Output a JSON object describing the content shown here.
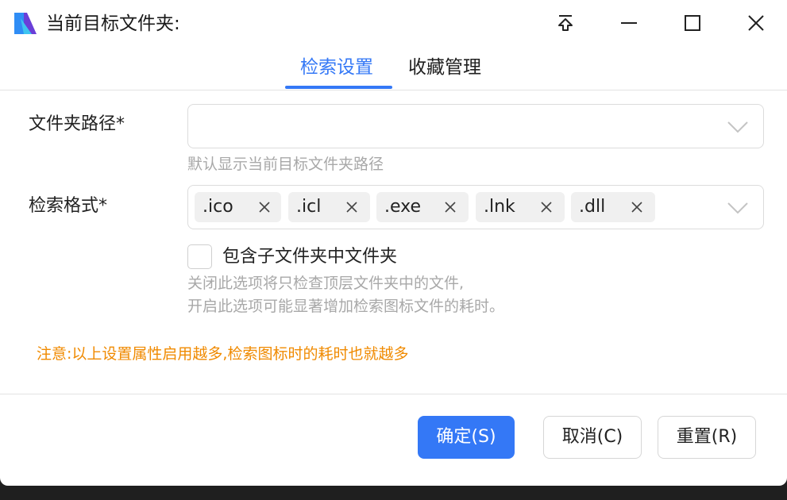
{
  "window": {
    "title": "当前目标文件夹:",
    "app_icon": "app-logo-icon",
    "controls": [
      "pin-top-icon",
      "minimize-icon",
      "maximize-icon",
      "close-icon"
    ]
  },
  "tabs": [
    {
      "label": "检索设置",
      "active": true
    },
    {
      "label": "收藏管理",
      "active": false
    }
  ],
  "form": {
    "path": {
      "label": "文件夹路径*",
      "value": "",
      "hint": "默认显示当前目标文件夹路径"
    },
    "format": {
      "label": "检索格式*",
      "tags": [
        ".ico",
        ".icl",
        ".exe",
        ".lnk",
        ".dll"
      ]
    },
    "include_subfolders": {
      "label": "包含子文件夹中文件夹",
      "checked": false,
      "hint_line1": "关闭此选项将只检查顶层文件夹中的文件,",
      "hint_line2": "开启此选项可能显著增加检索图标文件的耗时。"
    },
    "warning": "注意:以上设置属性启用越多,检索图标时的耗时也就越多"
  },
  "buttons": {
    "ok": "确定(S)",
    "cancel": "取消(C)",
    "reset": "重置(R)"
  },
  "colors": {
    "accent": "#3478f6",
    "warning": "#f08a00",
    "hint": "#a8a8a8"
  }
}
